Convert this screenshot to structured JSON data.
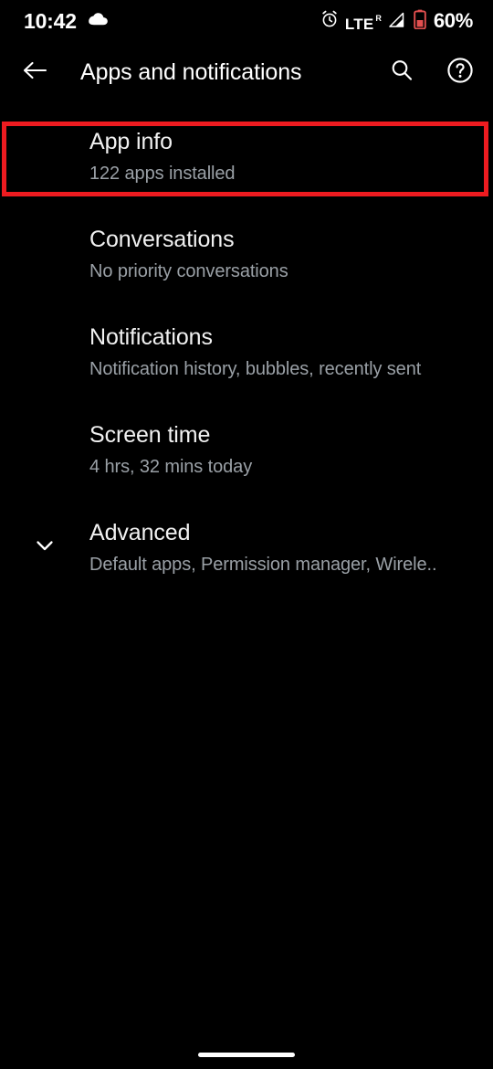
{
  "status_bar": {
    "time": "10:42",
    "cloud_icon": "cloud-icon",
    "alarm_icon": "alarm-icon",
    "network_type": "LTE",
    "roaming_indicator": "R",
    "signal_icon": "signal-bars-icon",
    "battery_icon": "battery-low-icon",
    "battery_percent": "60%",
    "battery_icon_color": "#e34f4f",
    "text_color": "#ffffff"
  },
  "toolbar": {
    "back_icon": "back-arrow-icon",
    "title": "Apps and notifications",
    "search_icon": "search-icon",
    "help_icon": "help-circle-icon"
  },
  "list": {
    "items": [
      {
        "name": "app-info",
        "title": "App info",
        "summary": "122 apps installed",
        "leading_icon": "",
        "highlighted": true
      },
      {
        "name": "conversations",
        "title": "Conversations",
        "summary": "No priority conversations",
        "leading_icon": "",
        "highlighted": false
      },
      {
        "name": "notifications",
        "title": "Notifications",
        "summary": "Notification history, bubbles, recently sent",
        "leading_icon": "",
        "highlighted": false
      },
      {
        "name": "screen-time",
        "title": "Screen time",
        "summary": "4 hrs, 32 mins today",
        "leading_icon": "",
        "highlighted": false
      },
      {
        "name": "advanced",
        "title": "Advanced",
        "summary": "Default apps, Permission manager, Wirele..",
        "leading_icon": "chevron-down-icon",
        "highlighted": false
      }
    ]
  },
  "annotation": {
    "color": "#ee1b20",
    "target": "app-info"
  },
  "nav_bar": {
    "gesture_pill": "home-gesture-pill"
  },
  "theme": {
    "background": "#000000",
    "title_text": "#f1f1f1",
    "summary_text": "#9aa0a6",
    "accent": "#ee1b20"
  }
}
